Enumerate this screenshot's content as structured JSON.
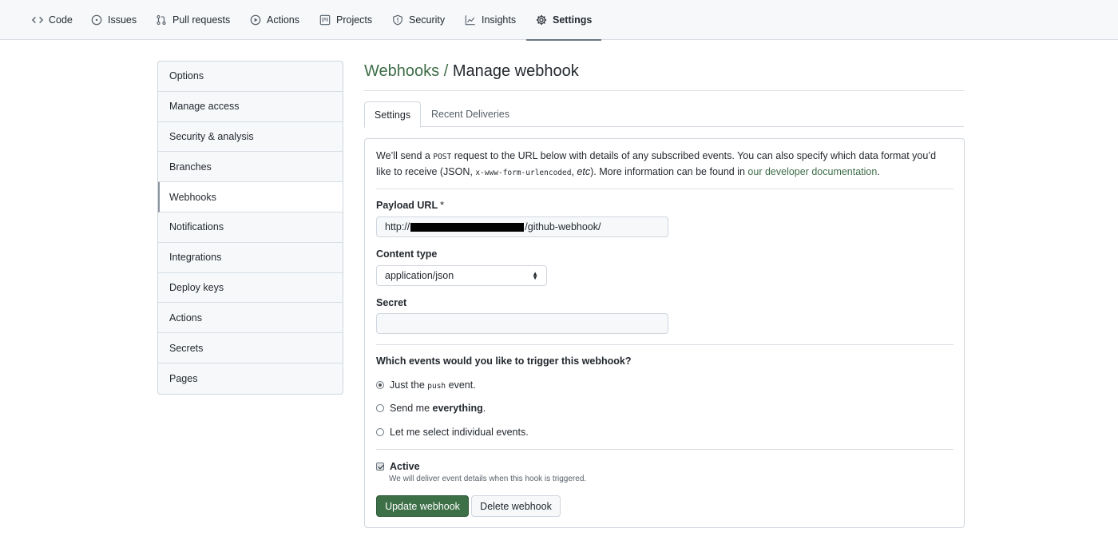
{
  "nav": {
    "items": [
      {
        "label": "Code",
        "icon": "code-icon"
      },
      {
        "label": "Issues",
        "icon": "issue-icon"
      },
      {
        "label": "Pull requests",
        "icon": "pull-request-icon"
      },
      {
        "label": "Actions",
        "icon": "play-icon"
      },
      {
        "label": "Projects",
        "icon": "project-icon"
      },
      {
        "label": "Security",
        "icon": "shield-icon"
      },
      {
        "label": "Insights",
        "icon": "graph-icon"
      },
      {
        "label": "Settings",
        "icon": "gear-icon",
        "active": true
      }
    ]
  },
  "sidebar": {
    "items": [
      {
        "label": "Options"
      },
      {
        "label": "Manage access"
      },
      {
        "label": "Security & analysis"
      },
      {
        "label": "Branches"
      },
      {
        "label": "Webhooks",
        "active": true
      },
      {
        "label": "Notifications"
      },
      {
        "label": "Integrations"
      },
      {
        "label": "Deploy keys"
      },
      {
        "label": "Actions"
      },
      {
        "label": "Secrets"
      },
      {
        "label": "Pages"
      }
    ]
  },
  "page": {
    "breadcrumb_parent": "Webhooks",
    "breadcrumb_separator": "/",
    "title": "Manage webhook"
  },
  "tabs": {
    "settings": "Settings",
    "recent_deliveries": "Recent Deliveries"
  },
  "intro": {
    "part1": "We’ll send a ",
    "code1": "POST",
    "part2": " request to the URL below with details of any subscribed events. You can also specify which data format you’d like to receive (JSON, ",
    "code2": "x-www-form-urlencoded",
    "part3": ", ",
    "etc": "etc",
    "part4": "). More information can be found in ",
    "link": "our developer documentation",
    "part5": "."
  },
  "form": {
    "payload_label": "Payload URL",
    "required_mark": "*",
    "payload_prefix": "http://",
    "payload_suffix": "/github-webhook/",
    "content_type_label": "Content type",
    "content_type_value": "application/json",
    "secret_label": "Secret",
    "secret_value": "",
    "events_question": "Which events would you like to trigger this webhook?",
    "option_push_pre": "Just the ",
    "option_push_code": "push",
    "option_push_post": " event.",
    "option_all_pre": "Send me ",
    "option_all_bold": "everything",
    "option_all_post": ".",
    "option_select": "Let me select individual events.",
    "active_label": "Active",
    "active_note": "We will deliver event details when this hook is triggered.",
    "update_button": "Update webhook",
    "delete_button": "Delete webhook"
  },
  "colors": {
    "accent_green": "#3e7048",
    "link_green": "#3d6d47"
  }
}
